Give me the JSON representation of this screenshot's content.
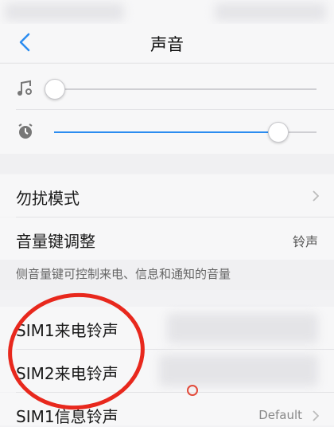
{
  "header": {
    "title": "声音"
  },
  "sliders": [
    {
      "icon": "music-note-icon",
      "level": 0.0
    },
    {
      "icon": "alarm-clock-icon",
      "level": 0.85
    }
  ],
  "rows": [
    {
      "label": "勿扰模式",
      "value": ""
    },
    {
      "label": "音量键调整",
      "value": "铃声"
    }
  ],
  "hint": "侧音量键可控制来电、信息和通知的音量",
  "ringtones": [
    {
      "label": "SIM1来电铃声"
    },
    {
      "label": "SIM2来电铃声"
    },
    {
      "label": "SIM1信息铃声",
      "value": "Default"
    }
  ],
  "colors": {
    "accent": "#2b8cf0",
    "annotation": "#e8281d"
  }
}
